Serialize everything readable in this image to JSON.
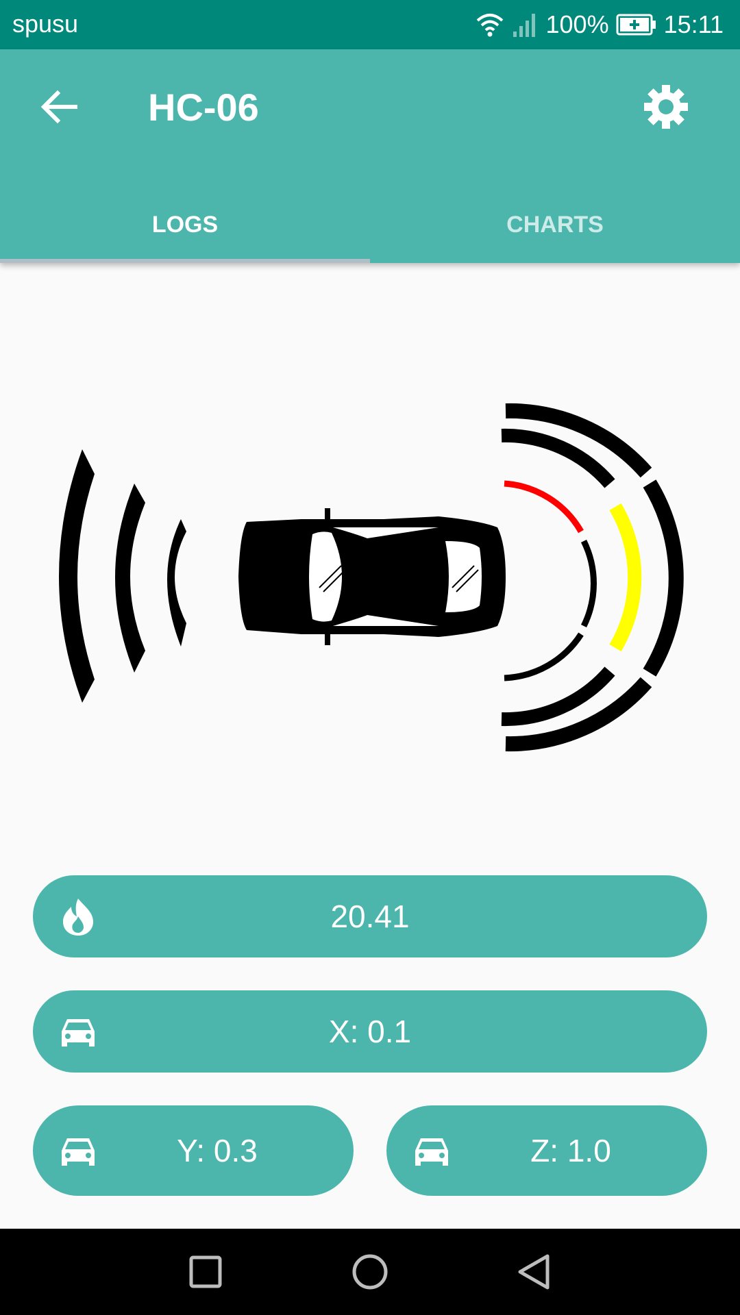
{
  "status_bar": {
    "carrier": "spusu",
    "battery": "100%",
    "time": "15:11",
    "icons": [
      "wifi-icon",
      "signal-icon",
      "battery-charging-icon"
    ]
  },
  "app_bar": {
    "title": "HC-06",
    "back_icon": "arrow-back-icon",
    "settings_icon": "gear-icon"
  },
  "tabs": [
    {
      "label": "LOGS",
      "selected": true
    },
    {
      "label": "CHARTS",
      "selected": false
    }
  ],
  "sensor_visual": {
    "icon": "car-top-view-icon",
    "left_waves": 3,
    "right_arcs": 3,
    "active_colors": {
      "near": "#ff0000",
      "mid": "#ffff00"
    }
  },
  "readings": {
    "temperature": {
      "value": "20.41",
      "icon": "flame-icon"
    },
    "x": {
      "label": "X: 0.1",
      "icon": "car-icon"
    },
    "y": {
      "label": "Y: 0.3",
      "icon": "car-icon"
    },
    "z": {
      "label": "Z: 1.0",
      "icon": "car-icon"
    }
  },
  "nav_bar": {
    "icons": [
      "recents-square-icon",
      "home-circle-icon",
      "back-triangle-icon"
    ]
  },
  "colors": {
    "status_bar": "#00897b",
    "app_bar": "#4db6ac",
    "pill": "#4db6ac",
    "background": "#fafafa"
  }
}
